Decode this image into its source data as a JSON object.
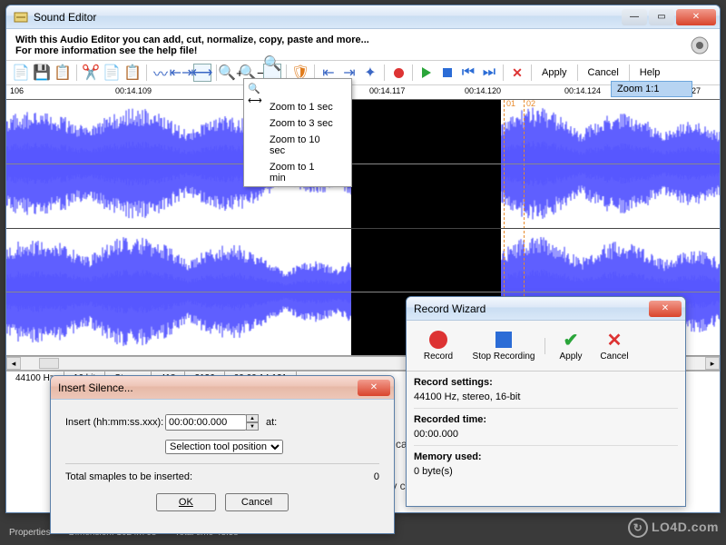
{
  "main_window": {
    "title": "Sound Editor",
    "hint_line1": "With this Audio Editor you can add, cut, normalize, copy, paste and more...",
    "hint_line2": "For more information see the help file!",
    "toolbar": {
      "apply": "Apply",
      "cancel": "Cancel",
      "help": "Help"
    },
    "ruler_ticks": [
      "106",
      "00:14.109",
      "00:14.117",
      "00:14.120",
      "00:14.124",
      "00:14.127"
    ],
    "ruler_positions": [
      4,
      120,
      400,
      505,
      615,
      725
    ],
    "markers": [
      "01",
      "02"
    ],
    "status": {
      "sample_rate": "44100 Hz",
      "bit_depth": "16 bit",
      "channels": "Stereo",
      "val_a": "418",
      "val_b": "3136",
      "timecode": "00:00:14.121"
    }
  },
  "zoom_menu": {
    "header": "Zoom 1:1",
    "items": [
      "Zoom to 1 sec",
      "Zoom to 3 sec",
      "Zoom to 10 sec",
      "Zoom to 1 min"
    ]
  },
  "insert_dialog": {
    "title": "Insert Silence...",
    "insert_label": "Insert (hh:mm:ss.xxx):",
    "time_value": "00:00:00.000",
    "at_label": "at:",
    "position_select": "Selection tool position",
    "total_label": "Total smaples to be inserted:",
    "total_value": "0",
    "ok": "OK",
    "cancel": "Cancel"
  },
  "record_dialog": {
    "title": "Record Wizard",
    "record": "Record",
    "stop": "Stop Recording",
    "apply": "Apply",
    "cancel": "Cancel",
    "settings_label": "Record settings:",
    "settings_value": "44100 Hz, stereo, 16-bit",
    "time_label": "Recorded time:",
    "time_value": "00:00.000",
    "mem_label": "Memory used:",
    "mem_value": "0 byte(s)"
  },
  "background": {
    "properties": "Properties",
    "dimension": "Dimension: 1024x768",
    "totaltime": "Total time 48.5s",
    "capture_word": "capture",
    "easy_word": "sily crea"
  },
  "watermark": "LO4D.com",
  "colors": {
    "wave": "#1b1bff",
    "wave_light": "#5a5aff",
    "selection_bg": "#000000",
    "marker": "#e88a2a"
  }
}
